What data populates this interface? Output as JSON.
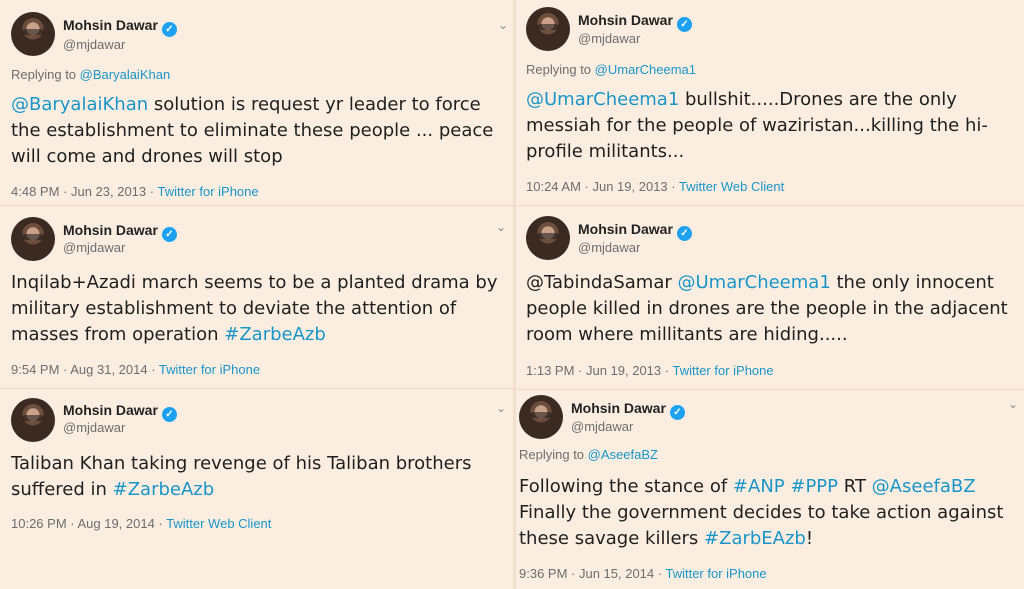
{
  "tweets": [
    {
      "name": "Mohsin Dawar",
      "handle": "@mjdawar",
      "reply_prefix": "Replying to ",
      "reply_to": "@BaryalaiKhan",
      "lines": [
        [
          {
            "t": "@BaryalaiKhan",
            "link": true
          },
          {
            "t": " solution is request yr leader to force"
          }
        ],
        [
          {
            "t": "the establishment to eliminate these people ... peace"
          }
        ],
        [
          {
            "t": "will come and drones will stop"
          }
        ]
      ],
      "time": "4:48 PM · Jun 23, 2013 · ",
      "source": "Twitter for iPhone"
    },
    {
      "name": "Mohsin Dawar",
      "handle": "@mjdawar",
      "lines": [
        [
          {
            "t": "Inqilab+Azadi march seems to be a planted drama by"
          }
        ],
        [
          {
            "t": "military establishment to deviate the attention of"
          }
        ],
        [
          {
            "t": "masses from operation "
          },
          {
            "t": "#ZarbeAzb",
            "link": true
          }
        ]
      ],
      "time": "9:54 PM · Aug 31, 2014 · ",
      "source": "Twitter for iPhone"
    },
    {
      "name": "Mohsin Dawar",
      "handle": "@mjdawar",
      "lines": [
        [
          {
            "t": "Taliban Khan taking revenge of his Taliban brothers"
          }
        ],
        [
          {
            "t": "suffered in "
          },
          {
            "t": "#ZarbeAzb",
            "link": true
          }
        ]
      ],
      "time": "10:26 PM · Aug 19, 2014 · ",
      "source": "Twitter Web Client"
    },
    {
      "name": "Mohsin Dawar",
      "handle": "@mjdawar",
      "reply_prefix": "Replying to ",
      "reply_to": "@UmarCheema1",
      "lines": [
        [
          {
            "t": "@UmarCheema1",
            "link": true
          },
          {
            "t": " bullshit.....Drones are the only"
          }
        ],
        [
          {
            "t": "messiah for the people of waziristan...killing the hi-"
          }
        ],
        [
          {
            "t": "profile militants..."
          }
        ]
      ],
      "time": "10:24 AM · Jun 19, 2013 · ",
      "source": "Twitter Web Client"
    },
    {
      "name": "Mohsin Dawar",
      "handle": "@mjdawar",
      "lines": [
        [
          {
            "t": "@TabindaSamar "
          },
          {
            "t": "@UmarCheema1",
            "link": true
          },
          {
            "t": " the only innocent"
          }
        ],
        [
          {
            "t": "people killed in drones are the people in the adjacent"
          }
        ],
        [
          {
            "t": "room where millitants are hiding....."
          }
        ]
      ],
      "time": "1:13 PM · Jun 19, 2013 · ",
      "source": "Twitter for iPhone"
    },
    {
      "name": "Mohsin Dawar",
      "handle": "@mjdawar",
      "reply_prefix": "Replying to ",
      "reply_to": "@AseefaBZ",
      "lines": [
        [
          {
            "t": "Following the stance of "
          },
          {
            "t": "#ANP",
            "link": true
          },
          {
            "t": " "
          },
          {
            "t": "#PPP",
            "link": true
          },
          {
            "t": " RT "
          },
          {
            "t": "@AseefaBZ",
            "link": true
          }
        ],
        [
          {
            "t": " Finally the government decides to take action against"
          }
        ],
        [
          {
            "t": "these savage killers "
          },
          {
            "t": "#ZarbEAzb",
            "link": true
          },
          {
            "t": "!"
          }
        ]
      ],
      "time": "9:36 PM · Jun 15, 2014 · ",
      "source": "Twitter for iPhone"
    }
  ],
  "icons": {
    "verified": "verified-badge-icon",
    "menu": "chevron-down-icon",
    "avatar": "avatar"
  },
  "colors": {
    "background": "#fbeee1",
    "link": "#1b95c9",
    "verified": "#1da1f2",
    "muted": "#6d6d6d"
  }
}
